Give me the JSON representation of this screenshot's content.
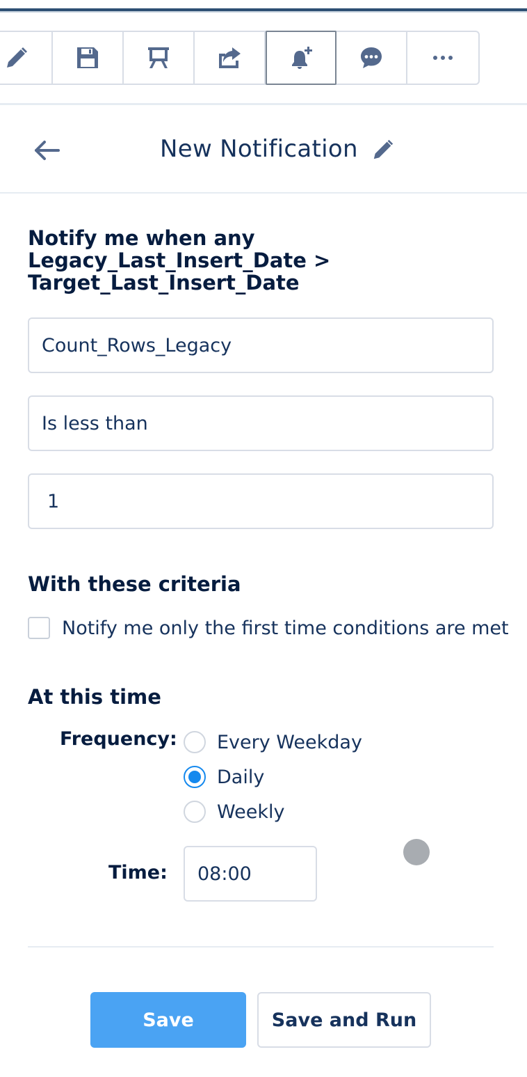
{
  "toolbar": {
    "buttons": [
      {
        "icon": "pencil-icon",
        "active": false
      },
      {
        "icon": "save-icon",
        "active": false
      },
      {
        "icon": "presentation-icon",
        "active": false
      },
      {
        "icon": "share-icon",
        "active": false
      },
      {
        "icon": "add-notification-icon",
        "active": true
      },
      {
        "icon": "comment-icon",
        "active": false
      },
      {
        "icon": "more-icon",
        "active": false
      }
    ]
  },
  "panel": {
    "title": "New Notification"
  },
  "condition": {
    "heading": "Notify me when any\nLegacy_Last_Insert_Date >\nTarget_Last_Insert_Date",
    "field": "Count_Rows_Legacy",
    "operator": "Is less than",
    "value": "1"
  },
  "criteria": {
    "title": "With these criteria",
    "first_time_label": "Notify me only the first time conditions are met",
    "first_time_checked": false
  },
  "schedule": {
    "title": "At this time",
    "frequency_label": "Frequency:",
    "options": [
      {
        "label": "Every Weekday",
        "checked": false
      },
      {
        "label": "Daily",
        "checked": true
      },
      {
        "label": "Weekly",
        "checked": false
      }
    ],
    "time_label": "Time:",
    "time_value": "08:00"
  },
  "actions": {
    "save_label": "Save",
    "save_and_run_label": "Save and Run"
  },
  "colors": {
    "primary": "#4aa3f3",
    "radio_selected": "#1589ee",
    "text": "#16325c",
    "border": "#d8dde6"
  }
}
